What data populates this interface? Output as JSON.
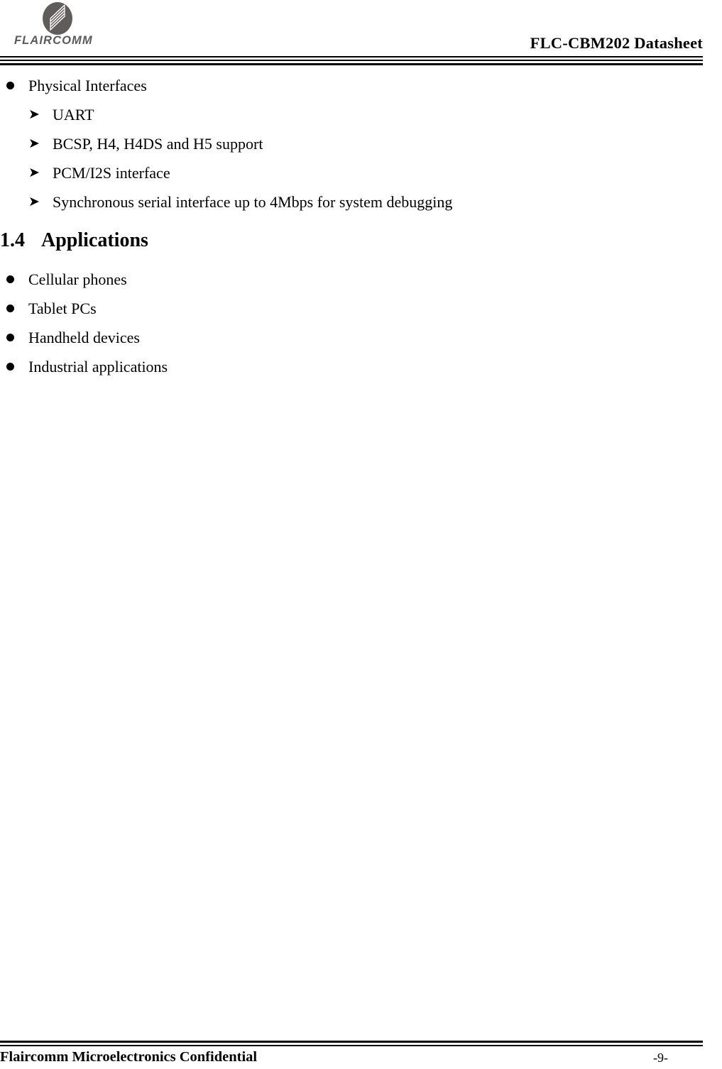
{
  "header": {
    "logo_icon": "flaircomm-ellipse-logo",
    "logo_wordmark": "FLAIRCOMM",
    "document_title": "FLC-CBM202 Datasheet"
  },
  "body": {
    "feature_section": {
      "bullet_label": "Physical Interfaces",
      "sub_items": [
        "UART",
        "BCSP, H4, H4DS and H5 support",
        "PCM/I2S interface",
        "Synchronous serial interface up to 4Mbps for system debugging"
      ]
    },
    "applications_section": {
      "heading_number": "1.4",
      "heading_text": "Applications",
      "items": [
        "Cellular phones",
        "Tablet PCs",
        "Handheld devices",
        "Industrial applications"
      ]
    }
  },
  "glyphs": {
    "sub_bullet": "➤"
  },
  "footer": {
    "confidential_notice": "Flaircomm Microelectronics Confidential",
    "page_number": "-9-"
  },
  "colors": {
    "text": "#000000",
    "logo_gray": "#5b5b5b",
    "rule": "#000000",
    "background": "#ffffff"
  }
}
